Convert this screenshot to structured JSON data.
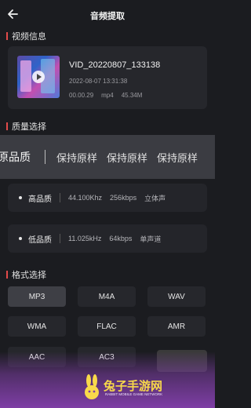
{
  "header": {
    "title": "音频提取",
    "back_icon": "arrow-left-icon"
  },
  "video_section": {
    "heading": "视频信息",
    "file_name": "VID_20220807_133138",
    "date": "2022-08-07 13:31:38",
    "duration": "00.00.29",
    "format": "mp4",
    "size": "45.34M"
  },
  "quality_section": {
    "heading": "质量选择",
    "options": [
      "原品质",
      "保持原样",
      "保持原样",
      "保持原样"
    ],
    "rows": [
      {
        "label": "高品质",
        "rate": "44.100Khz",
        "bitrate": "256kbps",
        "channel": "立体声"
      },
      {
        "label": "低品质",
        "rate": "11.025kHz",
        "bitrate": "64kbps",
        "channel": "单声道"
      }
    ]
  },
  "format_section": {
    "heading": "格式选择",
    "selected": "MP3",
    "formats": [
      "MP3",
      "M4A",
      "WAV",
      "WMA",
      "FLAC",
      "AMR",
      "AAC",
      "AC3"
    ]
  },
  "watermark": {
    "title": "兔子手游网",
    "subtitle": "RABBIT MOBILE GAME NETWORK"
  },
  "colors": {
    "accent": "#e24a4a",
    "background": "#1b1c20"
  }
}
